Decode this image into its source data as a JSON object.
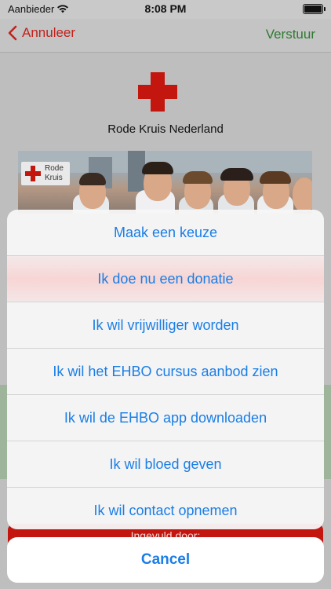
{
  "status": {
    "carrier": "Aanbieder",
    "time": "8:08 PM"
  },
  "nav": {
    "back_label": "Annuleer",
    "send_label": "Verstuur"
  },
  "org": {
    "name": "Rode Kruis Nederland",
    "badge_line1": "Rode",
    "badge_line2": "Kruis"
  },
  "form": {
    "filled_by_label": "Ingevuld door:"
  },
  "action_sheet": {
    "options": [
      {
        "label": "Maak een keuze"
      },
      {
        "label": "Ik doe nu een donatie"
      },
      {
        "label": "Ik wil vrijwilliger worden"
      },
      {
        "label": "Ik wil het EHBO cursus aanbod zien"
      },
      {
        "label": "Ik wil de EHBO app downloaden"
      },
      {
        "label": "Ik wil bloed geven"
      },
      {
        "label": "Ik wil contact opnemen"
      }
    ],
    "cancel_label": "Cancel"
  },
  "colors": {
    "accent_red": "#c2160e",
    "send_green": "#2f7a32",
    "ios_blue": "#1a7ee6"
  }
}
